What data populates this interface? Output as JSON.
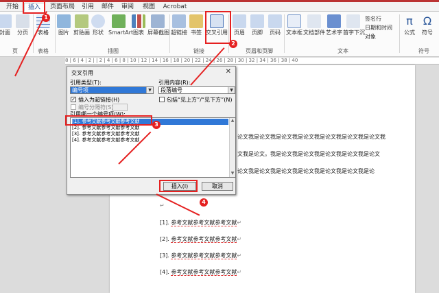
{
  "tabs": [
    "开始",
    "插入",
    "页面布局",
    "引用",
    "邮件",
    "审阅",
    "视图",
    "Acrobat"
  ],
  "ribbon": {
    "buttons": [
      "封面",
      "分页",
      "表格",
      "图片",
      "剪贴画",
      "形状",
      "SmartArt",
      "图表",
      "屏幕截图",
      "超链接",
      "书签",
      "交叉引用",
      "页眉",
      "页脚",
      "页码",
      "文本框",
      "文档部件",
      "艺术字",
      "首字下沉",
      "公式",
      "符号"
    ],
    "small": [
      "签名行",
      "日期和时间",
      "对象"
    ],
    "groups": [
      "页",
      "表格",
      "插图",
      "链接",
      "页眉和页脚",
      "文本",
      "符号"
    ]
  },
  "ruler": "8 | 6 | 4 | 2 | | 2 | 4 | 6 | 8 | 10 | 12 | 14 | 16 | 18 | 20 | 22 | 24 | 26 | 28 | 30 | 32 | 34 | 36 | 38 | 40",
  "dialog": {
    "title": "交叉引用",
    "close": "✕",
    "ref_type_label": "引用类型(T):",
    "ref_type_value": "编号项",
    "ref_content_label": "引用内容(R):",
    "ref_content_value": "段落编号",
    "insert_hyperlink_label": "插入为超链接(H)",
    "include_label": "包括“见上方”/“见下方”(N)",
    "separator_label": "编号分隔符(S)",
    "which_label": "引用哪一个编号项(W):",
    "items": [
      "[1]. 参考文献参考文献参考文献",
      "[2]. 参考文献参考文献参考文献",
      "[3]. 参考文献参考文献参考文献",
      "[4]. 参考文献参考文献参考文献"
    ],
    "insert_button": "插入(I)",
    "cancel_button": "取消"
  },
  "doc": {
    "paragraphs": [
      "论文我是论文我是论文我是论文我是论文我是论文我是论文我",
      "文我是论文。我是论文我是论文我是论文我是论文我是论文",
      "论文我是论文我是论文我是论文我是论文我是论文我是论"
    ],
    "refs": [
      {
        "num": "[1].",
        "text": "参考文献参考文献参考文献"
      },
      {
        "num": "[2].",
        "text": "参考文献参考文献参考文献"
      },
      {
        "num": "[3].",
        "text": "参考文献参考文献参考文献"
      },
      {
        "num": "[4].",
        "text": "参考文献参考文献参考文献"
      }
    ],
    "marks": [
      "↵",
      "↵",
      "↵",
      "↵",
      "↵"
    ]
  },
  "badges": [
    "1",
    "2",
    "3",
    "4"
  ],
  "colors": {
    "annotation": "#e52020",
    "selection": "#3078d7"
  }
}
